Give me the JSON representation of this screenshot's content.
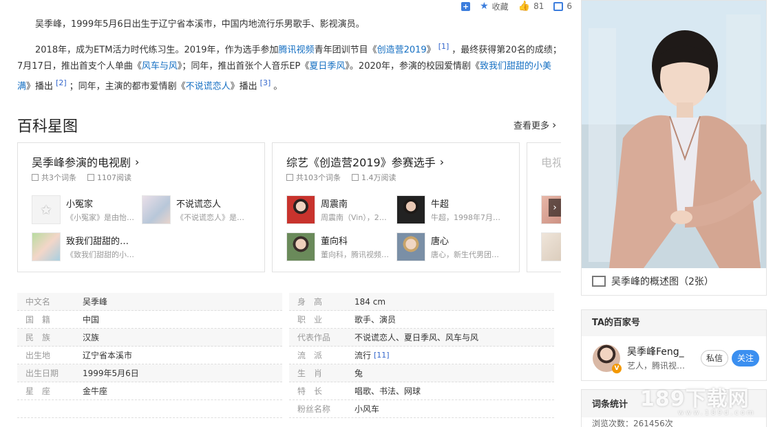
{
  "toolbar": {
    "collect_label": "收藏",
    "like_count": "81",
    "share_count": "6"
  },
  "summary": {
    "p1": "吴季峰，1999年5月6日出生于辽宁省本溪市，中国内地流行乐男歌手、影视演员。",
    "p2_a": "2018年，成为ETM活力时代练习生。2019年，作为选手参加",
    "p2_link_tencent": "腾讯视频",
    "p2_b": "青年团训节目《",
    "p2_link_cyy": "创造营2019",
    "p2_c": "》",
    "p2_ref1": "[1]",
    "p2_d": "，最终获得第20名的成绩；7月17日，推出首支个人单曲《",
    "p2_link_fcyf": "风车与风",
    "p2_e": "》；同年，推出首张个人音乐EP《",
    "p2_link_xrjf": "夏日季风",
    "p2_f": "》。2020年，参演的校园爱情剧《",
    "p2_link_zwm": "致我们甜甜的小美满",
    "p2_g": "》播出",
    "p2_ref2": "[2]",
    "p2_h": "；同年，主演的都市爱情剧《",
    "p2_link_bslar": "不说谎恋人",
    "p2_i": "》播出",
    "p2_ref3": "[3]",
    "p2_j": "。"
  },
  "star_map": {
    "title": "百科星图",
    "see_more": "查看更多",
    "cards": [
      {
        "title": "吴季峰参演的电视剧",
        "entries_count": "共3个词条",
        "reads": "1107阅读",
        "entries": [
          {
            "name": "小冤家",
            "desc": "《小冤家》是由怡…"
          },
          {
            "name": "不说谎恋人",
            "desc": "《不说谎恋人》是…"
          },
          {
            "name": "致我们甜甜的…",
            "desc": "《致我们甜甜的小…"
          }
        ]
      },
      {
        "title": "综艺《创造营2019》参赛选手",
        "entries_count": "共103个词条",
        "reads": "1.4万阅读",
        "entries": [
          {
            "name": "周震南",
            "desc": "周震南（Vin），2…"
          },
          {
            "name": "牛超",
            "desc": "牛超，1998年7月…"
          },
          {
            "name": "董向科",
            "desc": "董向科，腾讯视频…"
          },
          {
            "name": "唐心",
            "desc": "唐心，新生代男团…"
          }
        ]
      },
      {
        "title": "电视"
      }
    ]
  },
  "info": {
    "left": [
      {
        "k": "中文名",
        "v": "吴季峰",
        "link": false
      },
      {
        "k": "国　籍",
        "v": "中国",
        "link": true
      },
      {
        "k": "民　族",
        "v": "汉族",
        "link": false
      },
      {
        "k": "出生地",
        "v": "辽宁省本溪市",
        "link": false
      },
      {
        "k": "出生日期",
        "v": "1999年5月6日",
        "link": false
      },
      {
        "k": "星　座",
        "v": "金牛座",
        "link": true
      }
    ],
    "right": [
      {
        "k": "身　高",
        "v": "184 cm",
        "link": false
      },
      {
        "k": "职　业",
        "v": "歌手、演员",
        "link": false
      },
      {
        "k": "代表作品",
        "v": "不说谎恋人、夏日季风、风车与风",
        "link": true
      },
      {
        "k": "流　派",
        "v": "流行",
        "ref": "[11]",
        "link": false
      },
      {
        "k": "生　肖",
        "v": "兔",
        "link": false
      },
      {
        "k": "特　长",
        "v": "唱歌、书法、网球",
        "link": false
      },
      {
        "k": "粉丝名称",
        "v": "小风车",
        "link": false
      }
    ]
  },
  "sidebar": {
    "photo_caption": "吴季峰的概述图（2张）",
    "bjh_title": "TA的百家号",
    "bjh_name": "吴季峰Feng_",
    "bjh_desc": "艺人，腾讯视…",
    "btn_msg": "私信",
    "btn_follow": "关注",
    "stats_title": "词条统计",
    "stats_views": "浏览次数：261456次"
  },
  "watermark": {
    "main": "189下载网",
    "sub": "www.189d.com"
  },
  "colors": {
    "link": "#136ec2",
    "accent": "#3b7ddd",
    "follow": "#3b8ff0"
  }
}
